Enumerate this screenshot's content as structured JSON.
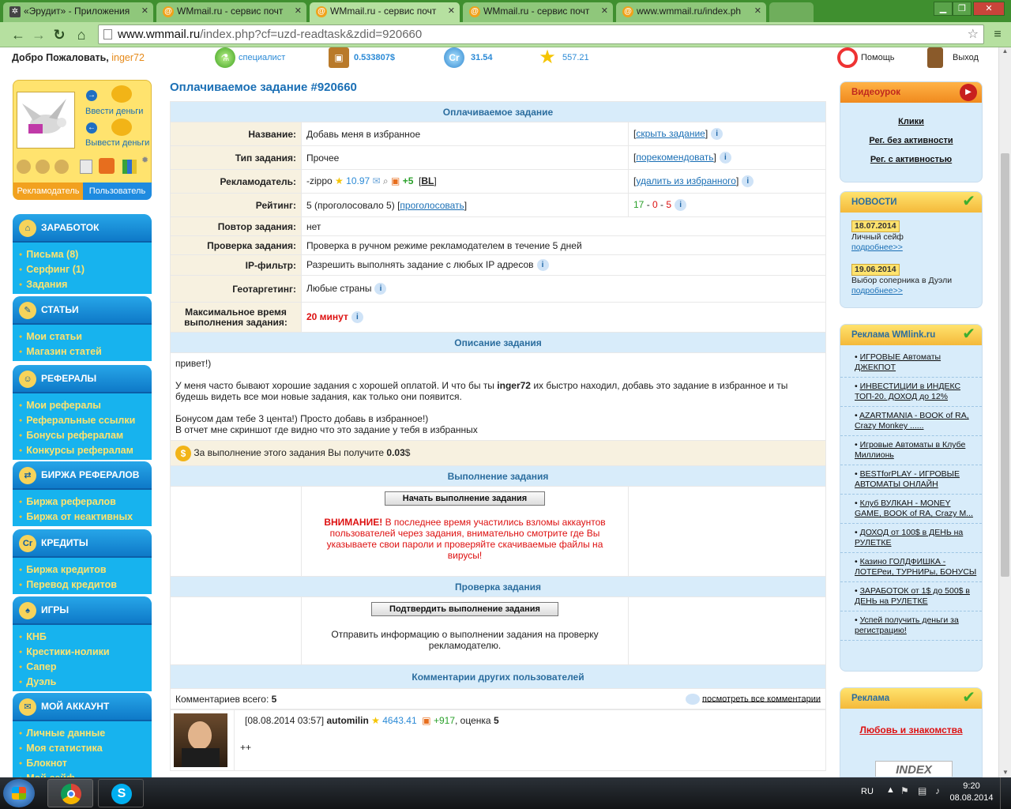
{
  "browser": {
    "tabs": [
      {
        "title": "«Эрудит» - Приложения",
        "active": false
      },
      {
        "title": "WMmail.ru - сервис почт",
        "active": false
      },
      {
        "title": "WMmail.ru - сервис почт",
        "active": true
      },
      {
        "title": "WMmail.ru - сервис почт",
        "active": false
      },
      {
        "title": "www.wmmail.ru/index.ph",
        "active": false
      }
    ],
    "url_host": "www.wmmail.ru",
    "url_path": "/index.php?cf=uzd-readtask&zdid=920660"
  },
  "topbar": {
    "welcome": "Добро Пожаловать,",
    "username": "inger72",
    "status": "специалист",
    "balance": "0.533807$",
    "credits_icon": "Cr",
    "credits": "31.54",
    "rating": "557.21",
    "help": "Помощь",
    "logout": "Выход"
  },
  "user_panel": {
    "deposit": "Ввести деньги",
    "withdraw": "Вывести деньги",
    "tab_advertiser": "Рекламодатель",
    "tab_user": "Пользователь"
  },
  "sidebar": [
    {
      "title": "ЗАРАБОТОК",
      "icon": "earnings-icon",
      "items": [
        "Письма (8)",
        "Серфинг (1)",
        "Задания"
      ]
    },
    {
      "title": "СТАТЬИ",
      "icon": "articles-icon",
      "items": [
        "Мои статьи",
        "Магазин статей"
      ]
    },
    {
      "title": "РЕФЕРАЛЫ",
      "icon": "referrals-icon",
      "items": [
        "Мои рефералы",
        "Реферальные ссылки",
        "Бонусы рефералам",
        "Конкурсы рефералам"
      ]
    },
    {
      "title": "БИРЖА РЕФЕРАЛОВ",
      "icon": "referral-exchange-icon",
      "items": [
        "Биржа рефералов",
        "Биржа от неактивных"
      ]
    },
    {
      "title": "КРЕДИТЫ",
      "icon": "credits-icon",
      "items": [
        "Биржа кредитов",
        "Перевод кредитов"
      ]
    },
    {
      "title": "ИГРЫ",
      "icon": "games-icon",
      "items": [
        "КНБ",
        "Крестики-нолики",
        "Сапер",
        "Дуэль"
      ]
    },
    {
      "title": "МОЙ АККАУНТ",
      "icon": "account-icon",
      "items": [
        "Личные данные",
        "Моя статистика",
        "Блокнот",
        "Мой сейф"
      ]
    }
  ],
  "task": {
    "page_title": "Оплачиваемое задание #920660",
    "section_main": "Оплачиваемое задание",
    "rows": [
      {
        "label": "Название:",
        "value": "Добавь меня в избранное",
        "action": "скрыть задание"
      },
      {
        "label": "Тип задания:",
        "value": "Прочее",
        "action": "порекомендовать"
      },
      {
        "label": "Рекламодатель:",
        "value": "-zippo",
        "action": "удалить из избранного"
      },
      {
        "label": "Рейтинг:",
        "value": "5 (проголосовало 5)",
        "action": ""
      },
      {
        "label": "Повтор задания:",
        "value": "нет"
      },
      {
        "label": "Проверка задания:",
        "value": "Проверка в ручном режиме рекламодателем в течение 5 дней"
      },
      {
        "label": "IP-фильтр:",
        "value": "Разрешить выполнять задание с любых IP адресов"
      },
      {
        "label": "Геотаргетинг:",
        "value": "Любые страны"
      },
      {
        "label": "Максимальное время выполнения задания:",
        "value": "20 минут"
      }
    ],
    "advertiser_rating": "10.97",
    "advertiser_plus": "+5",
    "advertiser_bl": "BL",
    "vote_link": "проголосовать",
    "rating_good": "17",
    "rating_neutral": "0",
    "rating_bad": "5",
    "section_desc": "Описание задания",
    "desc_greeting": "привет!)",
    "desc_p1_a": "У меня часто бывают хорошие задания с хорошей оплатой. И что бы ты",
    "desc_p1_user": "inger72",
    "desc_p1_b": "их быстро находил, добавь это задание в избранное и ты будешь видеть все мои новые задания, как только они появится.",
    "desc_p2": "Бонусом дам тебе 3 цента!) Просто добавь в избранное!)",
    "desc_p3": "В отчет мне скриншот где видно что это задание у тебя в избранных",
    "reward_text": "За выполнение этого задания Вы получите",
    "reward_value": "0.03",
    "reward_unit": "$",
    "section_exec": "Выполнение задания",
    "start_button": "Начать выполнение задания",
    "warning_title": "ВНИМАНИЕ!",
    "warning_text": "В последнее время участились взломы аккаунтов пользователей через задания, внимательно смотрите где Вы указываете свои пароли и проверяйте скачиваемые файлы на вирусы!",
    "section_check": "Проверка задания",
    "confirm_button": "Подтвердить выполнение задания",
    "confirm_text": "Отправить информацию о выполнении задания на проверку рекламодателю.",
    "section_comments": "Комментарии других пользователей",
    "comments_total_label": "Комментариев всего:",
    "comments_total": "5",
    "view_all_comments": "посмотреть все комментарии",
    "comment": {
      "date": "[08.08.2014 03:57]",
      "author": "automilin",
      "rating": "4643.41",
      "plus": "+917",
      "score_label": ", оценка",
      "score": "5",
      "text": "++"
    }
  },
  "right": {
    "video_title": "Видеоурок",
    "video_links": [
      "Клики",
      "Рег. без активности",
      "Рег. с активностью"
    ],
    "news_title": "НОВОСТИ",
    "news": [
      {
        "date": "18.07.2014",
        "text": "Личный сейф",
        "more": "подробнее>>"
      },
      {
        "date": "19.06.2014",
        "text": "Выбор соперника в Дуэли",
        "more": "подробнее>>"
      }
    ],
    "ads_title": "Реклама WMlink.ru",
    "ads": [
      "ИГРОВЫЕ Автоматы ДЖЕКПОТ",
      "ИНВЕСТИЦИИ в ИНДЕКС ТОП-20. ДОХОД до 12%",
      "AZARTMANIA - BOOK of RA, Crazy Monkey ......",
      "Игровые Автоматы в Клубе Миллионь",
      "BESTforPLAY - ИГРОВЫЕ АВТОМАТЫ ОНЛАЙН",
      "Клуб ВУЛКАН - MONEY GAME, BOOK of RA, Crazy M...",
      "ДОХОД от 100$ в ДЕНЬ на РУЛЕТКЕ",
      "Казино ГОЛДФИШКА - ЛОТЕРеи, ТУРНИРы, БОНУСЫ",
      "ЗАРАБОТОК от 1$ до 500$ в ДЕНЬ на РУЛЕТКЕ",
      "Успей получить деньги за регистрацию!"
    ],
    "ad2_title": "Реклама",
    "ad2_link": "Любовь и знакомства",
    "banner": "INDEX"
  },
  "taskbar": {
    "lang": "RU",
    "time": "9:20",
    "date": "08.08.2014"
  }
}
